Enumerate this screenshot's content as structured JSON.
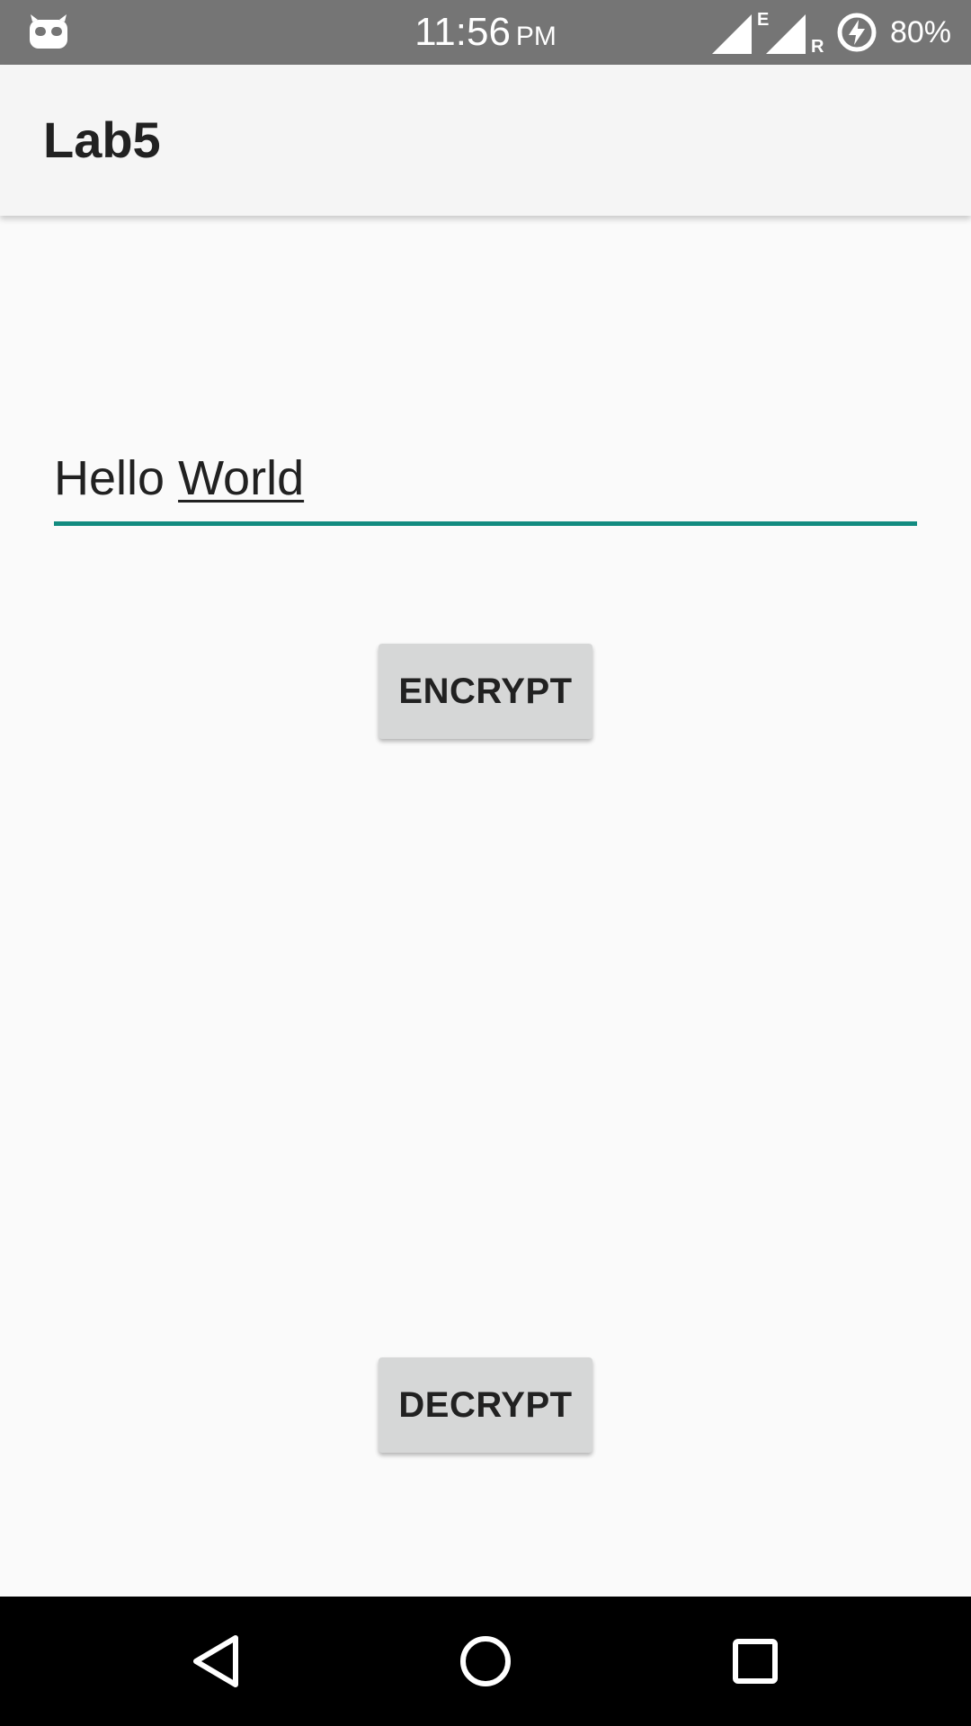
{
  "status_bar": {
    "time": "11:56",
    "ampm": "PM",
    "network_type": "E",
    "roaming": "R",
    "battery_percent": "80%",
    "icons": [
      "android-robot-icon",
      "signal-icon",
      "signal-roaming-icon",
      "battery-charging-icon"
    ]
  },
  "app_bar": {
    "title": "Lab5"
  },
  "input": {
    "value_first": "Hello ",
    "value_second": "World",
    "accent_color": "#128b80"
  },
  "buttons": {
    "encrypt_label": "ENCRYPT",
    "decrypt_label": "DECRYPT"
  },
  "nav_bar": {
    "icons": [
      "back-icon",
      "home-icon",
      "recents-icon"
    ]
  }
}
